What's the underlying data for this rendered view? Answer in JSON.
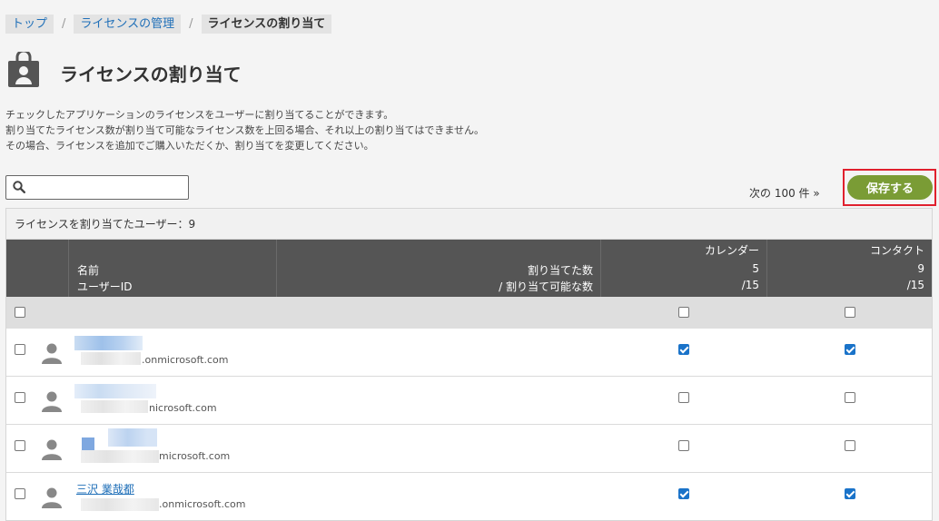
{
  "breadcrumb": {
    "items": [
      "トップ",
      "ライセンスの管理",
      "ライセンスの割り当て"
    ],
    "separator": "/"
  },
  "page": {
    "title": "ライセンスの割り当て",
    "description": [
      "チェックしたアプリケーションのライセンスをユーザーに割り当てることができます。",
      "割り当てたライセンス数が割り当て可能なライセンス数を上回る場合、それ以上の割り当てはできません。",
      "その場合、ライセンスを追加でご購入いただくか、割り当てを変更してください。"
    ]
  },
  "toolbar": {
    "search_placeholder": "",
    "next_label": "次の 100 件 »",
    "save_label": "保存する"
  },
  "table": {
    "assigned_count_label": "ライセンスを割り当てたユーザー：9",
    "headers": {
      "name": "名前",
      "user_id": "ユーザーID",
      "assigned": "割り当てた数",
      "assignable": "/ 割り当て可能な数",
      "apps": [
        {
          "name": "カレンダー",
          "assigned": "5",
          "total": "/15"
        },
        {
          "name": "コンタクト",
          "assigned": "9",
          "total": "/15"
        }
      ]
    },
    "rows": [
      {
        "name": "",
        "user_id": ".onmicrosoft.com",
        "selected": false,
        "calendar": true,
        "contact": true
      },
      {
        "name": "",
        "user_id": "nicrosoft.com",
        "selected": false,
        "calendar": false,
        "contact": false
      },
      {
        "name": "",
        "user_id": "microsoft.com",
        "selected": false,
        "calendar": false,
        "contact": false
      },
      {
        "name": "三沢 業哉都",
        "user_id": ".onmicrosoft.com",
        "selected": false,
        "calendar": true,
        "contact": true
      }
    ]
  },
  "colors": {
    "save_button": "#7a9c35",
    "highlight_border": "#e0202e",
    "link": "#1f6fb8",
    "header_bg": "#555555",
    "checkbox_checked": "#1a73c9"
  }
}
